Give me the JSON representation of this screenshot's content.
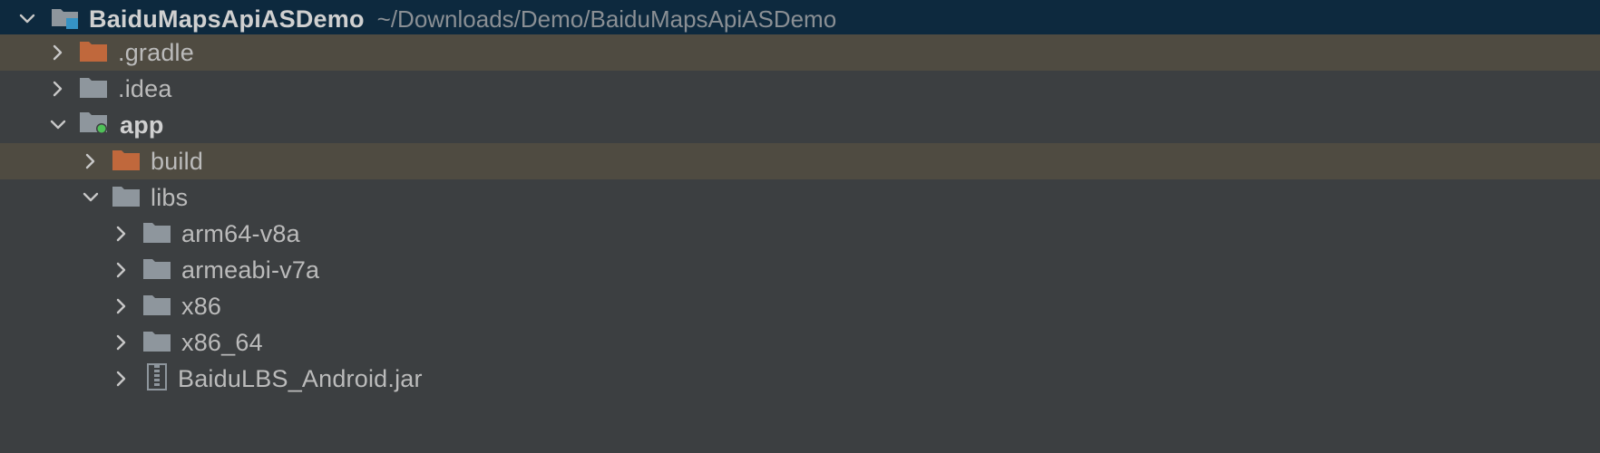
{
  "project_tree": {
    "root": {
      "name": "BaiduMapsApiASDemo",
      "path": "~/Downloads/Demo/BaiduMapsApiASDemo",
      "icon": "project-folder-icon",
      "expanded": true
    },
    "items": [
      {
        "label": ".gradle",
        "icon": "folder-icon",
        "color": "#c0683c",
        "expanded": false,
        "excluded": true
      },
      {
        "label": ".idea",
        "icon": "folder-icon",
        "color": "#8e969d",
        "expanded": false,
        "excluded": false
      },
      {
        "label": "app",
        "icon": "module-folder-icon",
        "color": "#8e969d",
        "expanded": true,
        "excluded": false
      },
      {
        "label": "build",
        "icon": "folder-icon",
        "color": "#c0683c",
        "expanded": false,
        "excluded": true
      },
      {
        "label": "libs",
        "icon": "folder-icon",
        "color": "#8e969d",
        "expanded": true,
        "excluded": false
      },
      {
        "label": "arm64-v8a",
        "icon": "folder-icon",
        "color": "#8e969d",
        "expanded": false,
        "excluded": false
      },
      {
        "label": "armeabi-v7a",
        "icon": "folder-icon",
        "color": "#8e969d",
        "expanded": false,
        "excluded": false
      },
      {
        "label": "x86",
        "icon": "folder-icon",
        "color": "#8e969d",
        "expanded": false,
        "excluded": false
      },
      {
        "label": "x86_64",
        "icon": "folder-icon",
        "color": "#8e969d",
        "expanded": false,
        "excluded": false
      },
      {
        "label": "BaiduLBS_Android.jar",
        "icon": "jar-archive-icon",
        "color": "#8e969d",
        "expanded": false,
        "excluded": false
      }
    ]
  },
  "colors": {
    "background": "#3c3f41",
    "root_selection": "#0d293e",
    "excluded_highlight": "#4f4b41",
    "module_dot": "#4fc158"
  }
}
